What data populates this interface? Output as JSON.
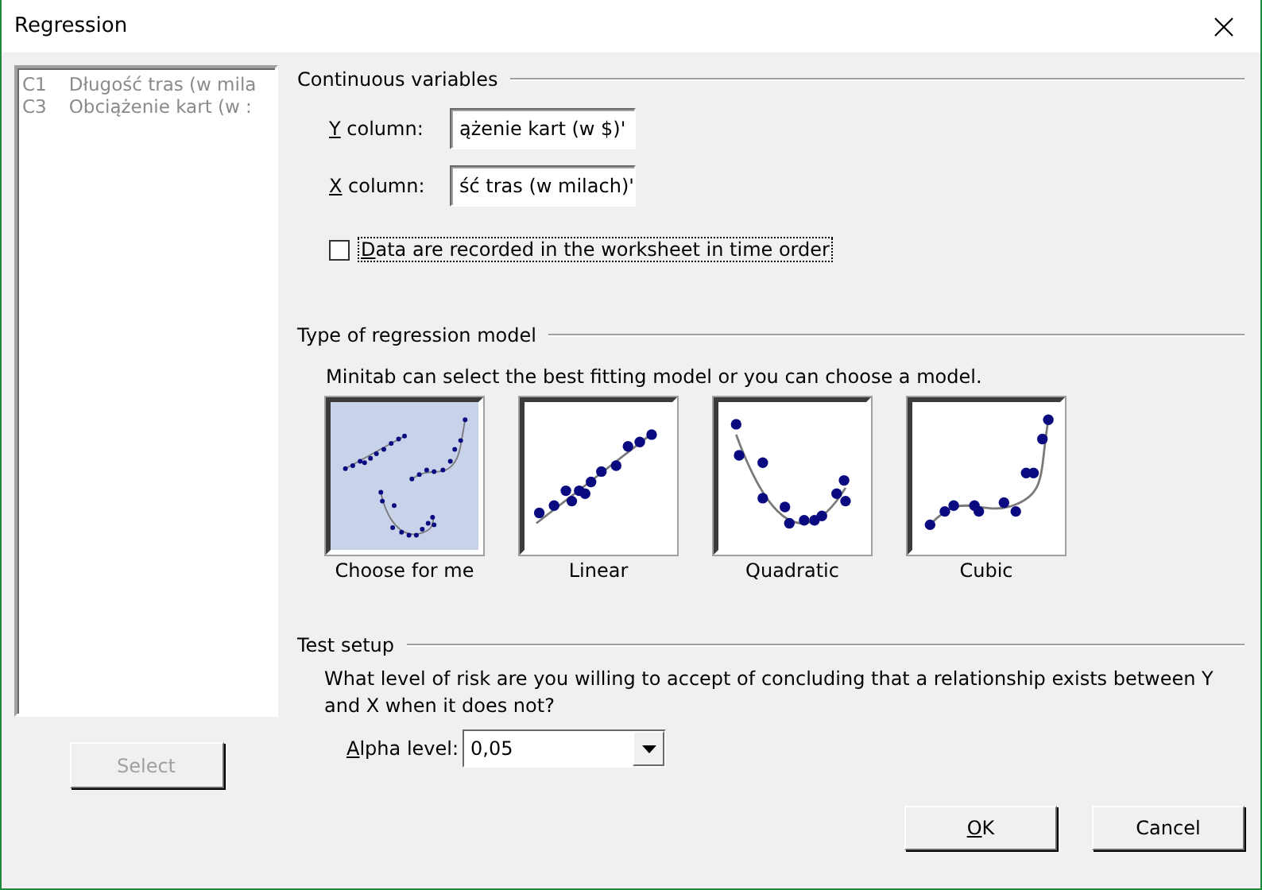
{
  "window": {
    "title": "Regression"
  },
  "columns_list": {
    "items": [
      {
        "id_label": "C1",
        "name": "Długość tras (w mila"
      },
      {
        "id_label": "C3",
        "name": "Obciążenie kart (w :"
      }
    ],
    "disabled": true
  },
  "select_button": {
    "label": "Select",
    "disabled": true
  },
  "continuous_variables": {
    "heading": "Continuous variables",
    "fields": [
      {
        "label": "Y column:",
        "value": "ążenie kart (w $)'",
        "underline_first": true
      },
      {
        "label": "X column:",
        "value": "ść tras (w milach)'",
        "underline_first": true
      }
    ],
    "time_order": {
      "label": "Data are recorded in the worksheet in time order",
      "checked": false,
      "focused": true,
      "underline_first": true
    }
  },
  "regression_model": {
    "heading": "Type of regression model",
    "description": "Minitab can select the best fitting model or you can choose a model.",
    "models": [
      {
        "kind": "auto",
        "label": "Choose for me",
        "selected": true
      },
      {
        "kind": "linear",
        "label": "Linear",
        "selected": false
      },
      {
        "kind": "quadratic",
        "label": "Quadratic",
        "selected": false
      },
      {
        "kind": "cubic",
        "label": "Cubic",
        "selected": false
      }
    ]
  },
  "test_setup": {
    "heading": "Test setup",
    "question": "What level of risk are you willing to accept of concluding that a relationship exists between Y and X when it does not?",
    "alpha": {
      "label": "Alpha level:",
      "value": "0,05",
      "underline_first": true
    }
  },
  "buttons": [
    {
      "label": "OK",
      "underline_first": true
    },
    {
      "label": "Cancel",
      "underline_first": false
    }
  ]
}
